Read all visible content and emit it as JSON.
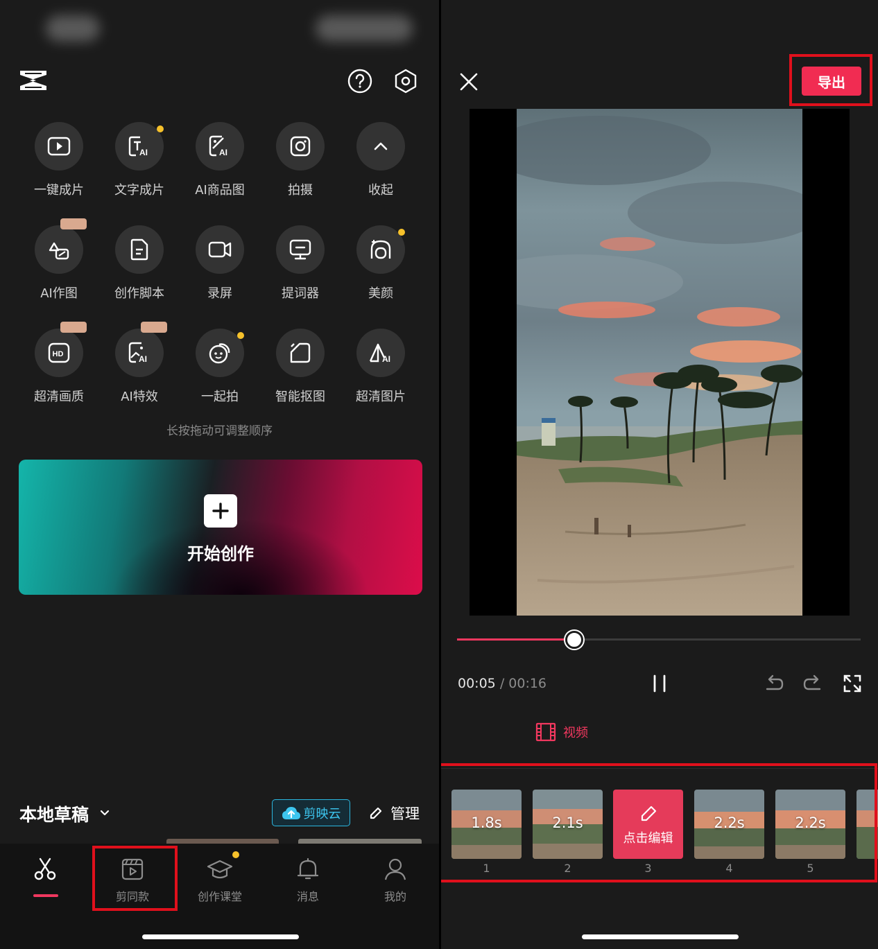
{
  "colors": {
    "accent": "#f2385f",
    "export_bg": "#f12c52",
    "highlight_box": "#e0101c",
    "notice_dot": "#f6c12b",
    "cloud": "#3dc6ef"
  },
  "home": {
    "logo": "capcut-logo",
    "header_icons": [
      "help-icon",
      "settings-hex-icon"
    ],
    "tools": [
      {
        "label": "一键成片",
        "icon": "play-square-icon",
        "badge": "none"
      },
      {
        "label": "文字成片",
        "icon": "text-ai-icon",
        "badge": "dot"
      },
      {
        "label": "AI商品图",
        "icon": "ai-product-icon",
        "badge": "none"
      },
      {
        "label": "拍摄",
        "icon": "camera-icon",
        "badge": "none"
      },
      {
        "label": "收起",
        "icon": "chevron-up-icon",
        "badge": "none"
      },
      {
        "label": "AI作图",
        "icon": "ai-draw-icon",
        "badge": "tag"
      },
      {
        "label": "创作脚本",
        "icon": "script-icon",
        "badge": "none"
      },
      {
        "label": "录屏",
        "icon": "screen-record-icon",
        "badge": "none"
      },
      {
        "label": "提词器",
        "icon": "teleprompter-icon",
        "badge": "none"
      },
      {
        "label": "美颜",
        "icon": "beauty-icon",
        "badge": "dot"
      },
      {
        "label": "超清画质",
        "icon": "hd-icon",
        "badge": "tag"
      },
      {
        "label": "AI特效",
        "icon": "ai-effect-icon",
        "badge": "tag"
      },
      {
        "label": "一起拍",
        "icon": "duet-icon",
        "badge": "dot"
      },
      {
        "label": "智能抠图",
        "icon": "cutout-icon",
        "badge": "none"
      },
      {
        "label": "超清图片",
        "icon": "ai-image-icon",
        "badge": "none"
      }
    ],
    "hint": "长按拖动可调整顺序",
    "create_label": "开始创作",
    "drafts_title": "本地草稿",
    "cloud_label": "剪映云",
    "manage_label": "管理",
    "tabs": [
      {
        "label": "",
        "icon": "scissors-icon",
        "active": true
      },
      {
        "label": "剪同款",
        "icon": "template-icon",
        "active": false
      },
      {
        "label": "创作课堂",
        "icon": "graduation-cap-icon",
        "active": false,
        "dot": true
      },
      {
        "label": "消息",
        "icon": "bell-icon",
        "active": false
      },
      {
        "label": "我的",
        "icon": "profile-icon",
        "active": false
      }
    ]
  },
  "editor": {
    "export_label": "导出",
    "progress_fraction": 0.29,
    "current_time": "00:05",
    "time_separator": "/",
    "total_time": "00:16",
    "video_tab_label": "视频",
    "clips": [
      {
        "duration": "1.8s",
        "number": "1"
      },
      {
        "duration": "2.1s",
        "number": "2"
      },
      {
        "duration": "",
        "number": "3",
        "edit_label": "点击编辑"
      },
      {
        "duration": "2.2s",
        "number": "4"
      },
      {
        "duration": "2.2s",
        "number": "5"
      }
    ]
  }
}
